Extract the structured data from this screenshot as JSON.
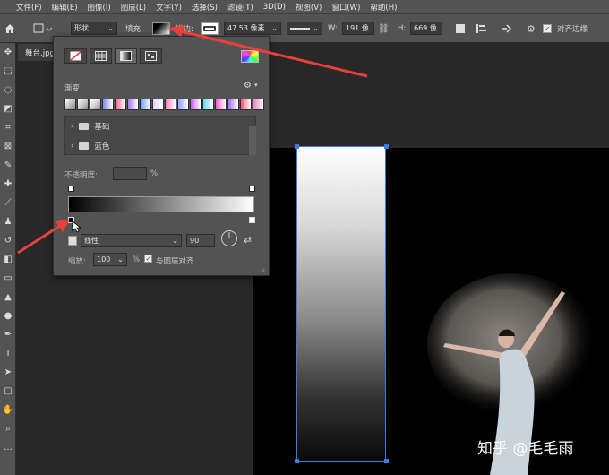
{
  "menu": [
    "文件(F)",
    "编辑(E)",
    "图像(I)",
    "图层(L)",
    "文字(Y)",
    "选择(S)",
    "滤镜(T)",
    "3D(D)",
    "视图(V)",
    "窗口(W)",
    "帮助(H)"
  ],
  "options": {
    "mode": "形状",
    "fill_label": "填充:",
    "stroke_label": "描边:",
    "stroke_width": "47.53 像素",
    "w_label": "W:",
    "w_value": "191 像",
    "h_label": "H:",
    "h_value": "669 像",
    "align_edges": "对齐边缘"
  },
  "doc_tab": "舞台.jpg",
  "panel": {
    "section_title": "渐变",
    "folders": [
      "基础",
      "蓝色"
    ],
    "opacity_label": "不透明度:",
    "opacity_value": "",
    "percent": "%",
    "gradient_type": "线性",
    "angle": "90",
    "scale_label": "缩放:",
    "scale_value": "100",
    "align_layer": "与图层对齐"
  },
  "swatch_colors": [
    "#bdbdbd",
    "#c8c8c8",
    "#d4d4d4",
    "#7d8ae0",
    "#f05c8a",
    "#a67be8",
    "#6aa0f0",
    "#e4d0ff",
    "#ff7ab8",
    "#8fa0ff",
    "#c65cf0",
    "#5fd8f0",
    "#f060c8",
    "#9a70f0",
    "#ff5080",
    "#f080c0"
  ],
  "watermark": "知乎 @毛毛雨",
  "colors": {
    "accent": "#3d7be0",
    "arrow": "#e8403a",
    "panel": "#535353"
  }
}
